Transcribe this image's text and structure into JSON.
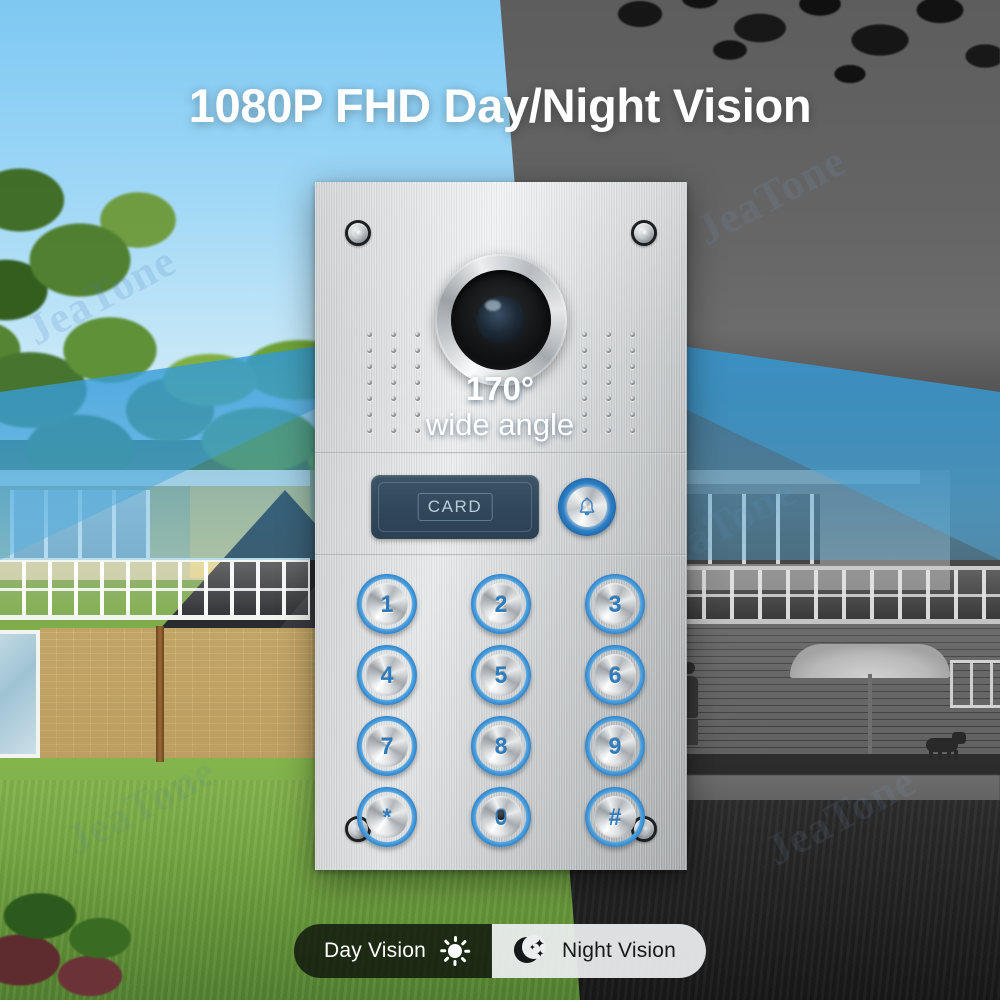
{
  "headline": "1080P FHD Day/Night Vision",
  "overlay": {
    "angle_value": "170°",
    "angle_label": "wide angle"
  },
  "device": {
    "card_reader_label": "CARD",
    "bell_icon": "bell-icon",
    "keypad": [
      "1",
      "2",
      "3",
      "4",
      "5",
      "6",
      "7",
      "8",
      "9",
      "*",
      "0",
      "#"
    ]
  },
  "pills": [
    {
      "label": "Day Vision",
      "icon": "sun-icon"
    },
    {
      "label": "Night Vision",
      "icon": "moon-stars-icon"
    }
  ],
  "watermarks": [
    "JeaTone",
    "JeaTone",
    "JeaTone",
    "JeaTone",
    "JeaTone",
    "JeaTone"
  ],
  "colors": {
    "headline_text": "#ffffff",
    "day_sky": "#7ec8f2",
    "night_sky": "#5c5d5f",
    "cone_blue": "#3f9fd6",
    "key_accent": "#2f7cbd",
    "panel_dark": "#31485a",
    "pill_day_bg": "#0c100a",
    "pill_night_bg": "#eceef0"
  }
}
